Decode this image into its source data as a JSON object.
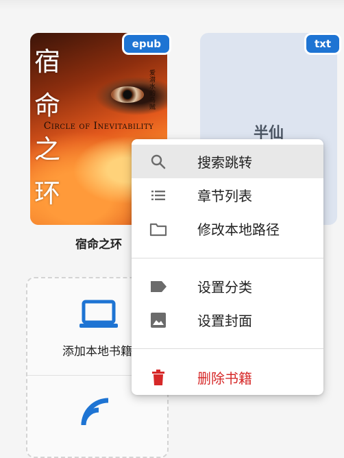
{
  "books": [
    {
      "title": "宿命之环",
      "format": "epub",
      "cover_title": "宿命之环",
      "cover_subtitle": "Circle of Inevitability",
      "cover_author": "爱潜水的乌贼"
    },
    {
      "title": "半仙",
      "format": "txt",
      "cover_title": "半仙"
    }
  ],
  "add_panel": {
    "items": [
      {
        "label": "添加本地书籍",
        "icon": "laptop-icon"
      },
      {
        "label": "",
        "icon": "rss-feed-icon"
      }
    ]
  },
  "context_menu": {
    "items": [
      {
        "label": "搜索跳转",
        "icon": "search-icon",
        "highlighted": true
      },
      {
        "label": "章节列表",
        "icon": "list-icon"
      },
      {
        "label": "修改本地路径",
        "icon": "folder-icon"
      },
      {
        "label": "设置分类",
        "icon": "label-icon"
      },
      {
        "label": "设置封面",
        "icon": "image-icon"
      },
      {
        "label": "删除书籍",
        "icon": "trash-icon",
        "danger": true
      }
    ]
  },
  "colors": {
    "badge": "#1e74d3",
    "danger": "#d62828",
    "accent_blue": "#1e74d3",
    "highlight": "#e8e8e8"
  }
}
